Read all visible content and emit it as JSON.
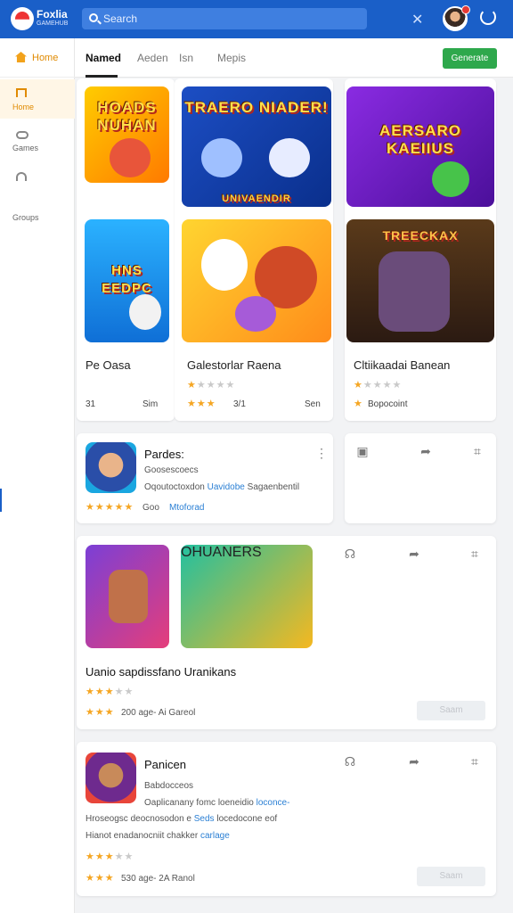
{
  "header": {
    "brand": "Foxlia",
    "brand_sub": "GAMEHUB",
    "search_placeholder": "Search",
    "close_glyph": "✕"
  },
  "sidebar": {
    "home_label": "Home",
    "items": [
      {
        "icon": "home-icon",
        "label": "Home",
        "active": true
      },
      {
        "icon": "gamepad-icon",
        "label": "Games"
      },
      {
        "icon": "headset-icon",
        "label": ""
      },
      {
        "icon": "",
        "label": "Groups"
      }
    ]
  },
  "tabs": {
    "items": [
      "Named",
      "Aeden",
      "Isn",
      "Mepis"
    ],
    "active": "Named",
    "cta": "Generate"
  },
  "games": [
    {
      "thumb_top": "HOADS NUHAN",
      "name": "",
      "stars": 0,
      "meta": "",
      "rating": ""
    },
    {
      "thumb_top": "TRAERO NIADER!",
      "thumb_bottom": "UNIVAENDIR",
      "name": "",
      "stars": 0,
      "meta": ""
    },
    {
      "thumb_top": "AERSARO KAEIIUS",
      "name": "",
      "stars": 0,
      "meta": ""
    },
    {
      "thumb_top": "HNS EEDPC",
      "name": "Pe Oasa",
      "stars_row1": "",
      "meta_left": "31",
      "meta_right": "Sim"
    },
    {
      "thumb_top": "",
      "name": "Galestorlar Raena",
      "stars_row1": 1,
      "stars_row2": 3,
      "meta_left": "3/1",
      "meta_right": "Sen"
    },
    {
      "thumb_top": "TREECKAX",
      "name": "Cltiikaadai Banean",
      "stars_row1": 1,
      "stars_row2": 1,
      "meta_left": "Bopocoint",
      "meta_right": ""
    }
  ],
  "cards": [
    {
      "title": "Pardes:",
      "sub": "Goosescoecs",
      "line1": "Oqoutoctoxdon",
      "line1_link": "Uavidobe",
      "line1_tail": "Sagaenbentil",
      "stars": 5,
      "meta": "Goo",
      "link": "Mtoforad"
    },
    {
      "thumb_label": "OHUANERS",
      "title": "Uanio sapdissfano Uranikans",
      "stars_row1": 3,
      "stars_row2": 3,
      "meta": "200 age-  Ai Gareol",
      "button": "Saam"
    },
    {
      "title": "Panicen",
      "sub": "Babdocceos",
      "line1": "Oaplicanany fomc loeneidio",
      "line1_link": "loconce-",
      "line2": "Hroseogsc deocnosodon e",
      "line2_link": "Seds",
      "line2_tail": "locedocone eof",
      "line3": "Hianot enadanocniit chakker",
      "line3_link": "carlage",
      "stars_row1": 3,
      "stars_row2": 3,
      "meta": "530 age-  2A Ranol",
      "button": "Saam"
    }
  ],
  "colors": {
    "brand_blue": "#1a5fc8",
    "accent_orange": "#e08a00",
    "cta_green": "#2ea84c",
    "star": "#f5a623"
  }
}
